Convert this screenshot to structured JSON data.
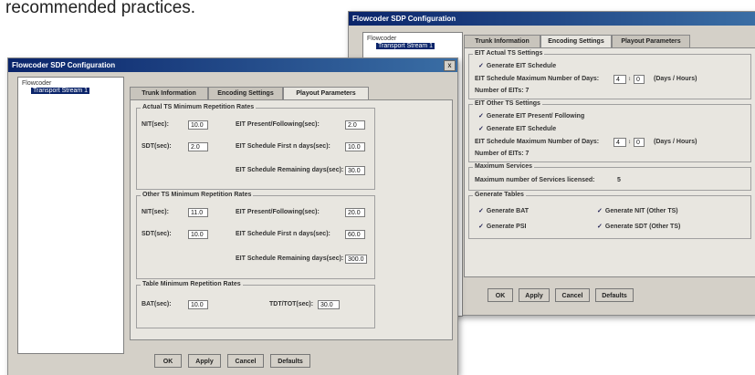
{
  "doc": {
    "text": "recommended practices."
  },
  "back_window": {
    "title": "Flowcoder SDP Configuration",
    "tree": {
      "root": "Flowcoder",
      "child": "Transport Stream 1"
    },
    "tabs": [
      "Trunk Information",
      "Encoding Settings",
      "Playout Parameters"
    ],
    "eit_actual": {
      "title": "EIT Actual TS Settings",
      "checkbox": "Generate EIT Schedule",
      "max_days_label": "EIT Schedule Maximum Number of Days:",
      "days_value": "4",
      "hours_value": "0",
      "unit_label": "(Days / Hours)",
      "count_label": "Number of EITs: 7"
    },
    "eit_other": {
      "title": "EIT Other TS Settings",
      "checkbox1": "Generate EIT Present/ Following",
      "checkbox2": "Generate EIT Schedule",
      "max_days_label": "EIT Schedule Maximum Number of Days:",
      "days_value": "4",
      "hours_value": "0",
      "unit_label": "(Days / Hours)",
      "count_label": "Number of EITs: 7"
    },
    "max_services": {
      "title": "Maximum Services",
      "label": "Maximum number of Services licensed:",
      "value": "5"
    },
    "generate_tables": {
      "title": "Generate Tables",
      "items": [
        "Generate BAT",
        "Generate NIT (Other TS)",
        "Generate PSI",
        "Generate SDT (Other TS)"
      ]
    },
    "buttons": {
      "ok": "OK",
      "apply": "Apply",
      "cancel": "Cancel",
      "defaults": "Defaults"
    }
  },
  "front_window": {
    "title": "Flowcoder SDP Configuration",
    "close": "x",
    "tree": {
      "root": "Flowcoder",
      "child": "Transport Stream 1"
    },
    "tabs": [
      "Trunk Information",
      "Encoding Settings",
      "Playout Parameters"
    ],
    "actual_ts": {
      "title": "Actual TS Minimum Repetition Rates",
      "nit_label": "NIT(sec):",
      "nit_value": "10.0",
      "sdt_label": "SDT(sec):",
      "sdt_value": "2.0",
      "eit_pf_label": "EIT Present/Following(sec):",
      "eit_pf_value": "2.0",
      "eit_first_label": "EIT Schedule First n days(sec):",
      "eit_first_value": "10.0",
      "eit_rem_label": "EIT Schedule Remaining days(sec):",
      "eit_rem_value": "30.0"
    },
    "other_ts": {
      "title": "Other TS Minimum Repetition Rates",
      "nit_label": "NIT(sec):",
      "nit_value": "11.0",
      "sdt_label": "SDT(sec):",
      "sdt_value": "10.0",
      "eit_pf_label": "EIT Present/Following(sec):",
      "eit_pf_value": "20.0",
      "eit_first_label": "EIT Schedule First n days(sec):",
      "eit_first_value": "60.0",
      "eit_rem_label": "EIT Schedule Remaining days(sec):",
      "eit_rem_value": "300.0"
    },
    "table_min": {
      "title": "Table Minimum Repetition Rates",
      "bat_label": "BAT(sec):",
      "bat_value": "10.0",
      "tdt_label": "TDT/TOT(sec):",
      "tdt_value": "30.0"
    },
    "buttons": {
      "ok": "OK",
      "apply": "Apply",
      "cancel": "Cancel",
      "defaults": "Defaults"
    }
  }
}
